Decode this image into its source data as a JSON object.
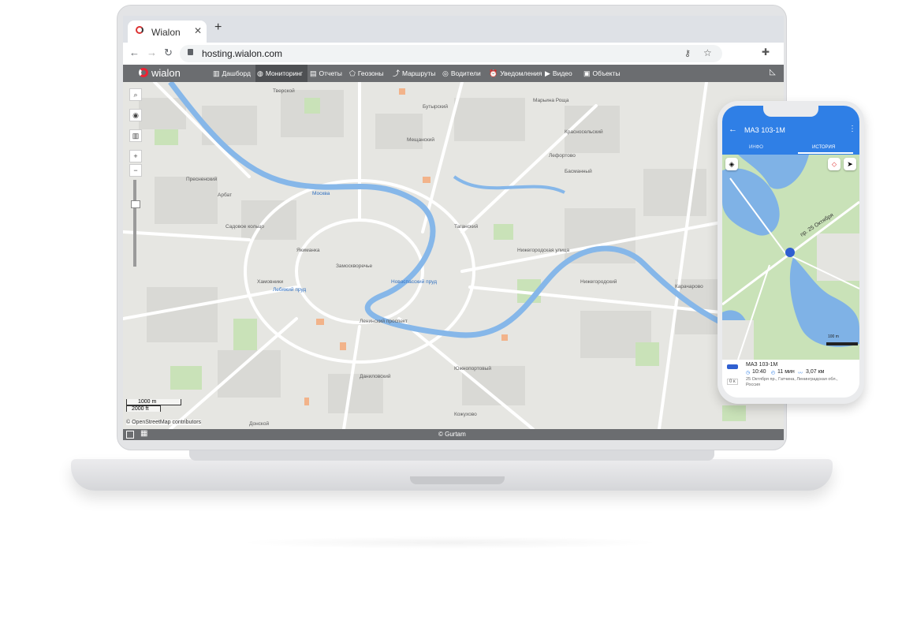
{
  "browser": {
    "tab_title": "Wialon",
    "new_tab": "+",
    "url": "hosting.wialon.com"
  },
  "app": {
    "logo_text": "wialon",
    "menu": [
      {
        "label": "Дашборд",
        "icon": "chart-icon"
      },
      {
        "label": "Мониторинг",
        "icon": "globe-icon",
        "active": true
      },
      {
        "label": "Отчеты",
        "icon": "report-icon"
      },
      {
        "label": "Геозоны",
        "icon": "geofence-icon"
      },
      {
        "label": "Маршруты",
        "icon": "route-icon"
      },
      {
        "label": "Водители",
        "icon": "driver-icon"
      },
      {
        "label": "Уведомления",
        "icon": "alarm-icon"
      },
      {
        "label": "Видео",
        "icon": "video-icon"
      },
      {
        "label": "Объекты",
        "icon": "bus-icon"
      }
    ]
  },
  "map": {
    "scale_m": "1000 m",
    "scale_ft": "2000 ft",
    "attribution": "© OpenStreetMap contributors",
    "footer": "© Gurtam",
    "labels": [
      "Тверской",
      "Бутырский",
      "Марьина Роща",
      "Мещанский",
      "Красносельский",
      "Басманный",
      "Пресненский",
      "Арбат",
      "Хамовники",
      "Якиманка",
      "Замоскворечье",
      "Таганский",
      "Лефортово",
      "Нижегородский",
      "Южнопортовый",
      "Даниловский",
      "Донской",
      "Москва",
      "Садовое кольцо",
      "Нижегородская улица",
      "Ленинский проспект",
      "Новоспасский пруд",
      "Лебяжий пруд",
      "Кожухово",
      "Карачарово"
    ]
  },
  "phone": {
    "title": "МАЗ 103-1М",
    "tabs": [
      "ИНФО",
      "ИСТОРИЯ"
    ],
    "active_tab": "ИСТОРИЯ",
    "map_street": "пр. 25 Октября",
    "scale": "100 m",
    "unit_name": "МАЗ 103-1М",
    "time": "10:40",
    "duration": "11 мин",
    "distance": "3,07 км",
    "address": "25 Октября пр., Гатчина, Ленинградская обл., Россия",
    "speed_badge": "0 к"
  },
  "colors": {
    "appbar": "#6b6d70",
    "phone_header": "#2f7fe6",
    "water": "#7fb2e6",
    "park": "#c9e2b8"
  }
}
